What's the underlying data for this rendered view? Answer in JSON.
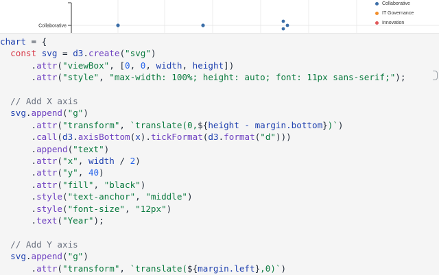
{
  "chart_preview": {
    "y_label": "Collaborative",
    "legend": [
      {
        "label": "Collaborative",
        "color": "#3b6ea8"
      },
      {
        "label": "IT Governance",
        "color": "#f28e2b"
      },
      {
        "label": "Innovation",
        "color": "#e15759"
      }
    ]
  },
  "code": {
    "lines": [
      "chart = {",
      "  const svg = d3.create(\"svg\")",
      "      .attr(\"viewBox\", [0, 0, width, height])",
      "      .attr(\"style\", \"max-width: 100%; height: auto; font: 11px sans-serif;\");",
      "",
      "  // Add X axis",
      "  svg.append(\"g\")",
      "      .attr(\"transform\", `translate(0,${height - margin.bottom})`)",
      "      .call(d3.axisBottom(x).tickFormat(d3.format(\"d\")))",
      "      .append(\"text\")",
      "      .attr(\"x\", width / 2)",
      "      .attr(\"y\", 40)",
      "      .attr(\"fill\", \"black\")",
      "      .style(\"text-anchor\", \"middle\")",
      "      .style(\"font-size\", \"12px\")",
      "      .text(\"Year\");",
      "",
      "  // Add Y axis",
      "  svg.append(\"g\")",
      "      .attr(\"transform\", `translate(${margin.left},0)`)"
    ]
  }
}
